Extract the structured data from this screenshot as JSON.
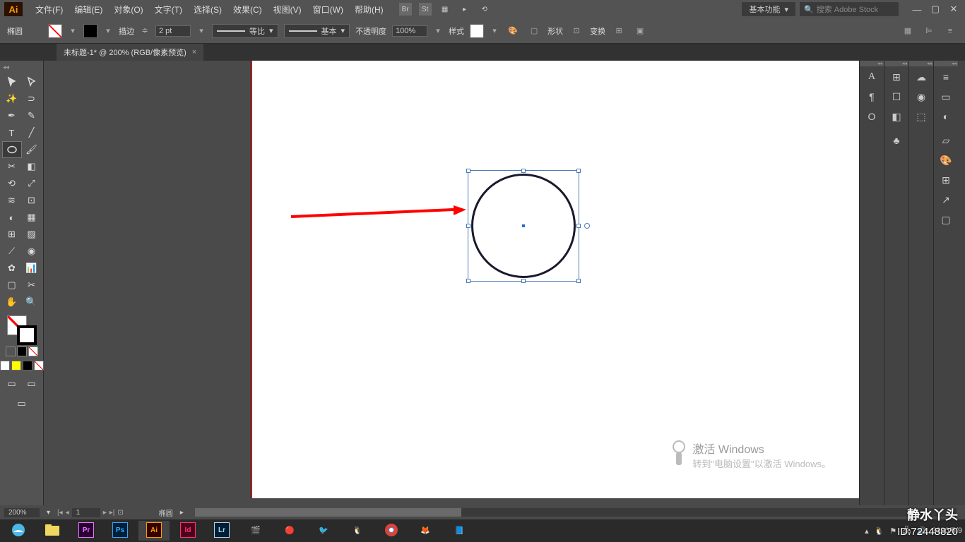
{
  "menubar": {
    "items": [
      "文件(F)",
      "编辑(E)",
      "对象(O)",
      "文字(T)",
      "选择(S)",
      "效果(C)",
      "视图(V)",
      "窗口(W)",
      "帮助(H)"
    ],
    "workspace": "基本功能",
    "search_placeholder": "搜索 Adobe Stock"
  },
  "controlbar": {
    "shape_label": "椭圆",
    "stroke_label": "描边",
    "stroke_weight": "2 pt",
    "dash_label": "等比",
    "profile_label": "基本",
    "opacity_label": "不透明度",
    "opacity_value": "100%",
    "style_label": "样式",
    "shape_btn": "形状",
    "transform_btn": "变换"
  },
  "doctab": {
    "title": "未标题-1* @ 200% (RGB/像素预览)"
  },
  "statusbar": {
    "zoom": "200%",
    "page": "1",
    "tool": "椭圆"
  },
  "watermark": {
    "title": "激活 Windows",
    "sub": "转到\"电脑设置\"以激活 Windows。",
    "name": "静水丫头",
    "id": "ID:72448820"
  },
  "taskbar": {
    "date": "2020/5/9"
  }
}
